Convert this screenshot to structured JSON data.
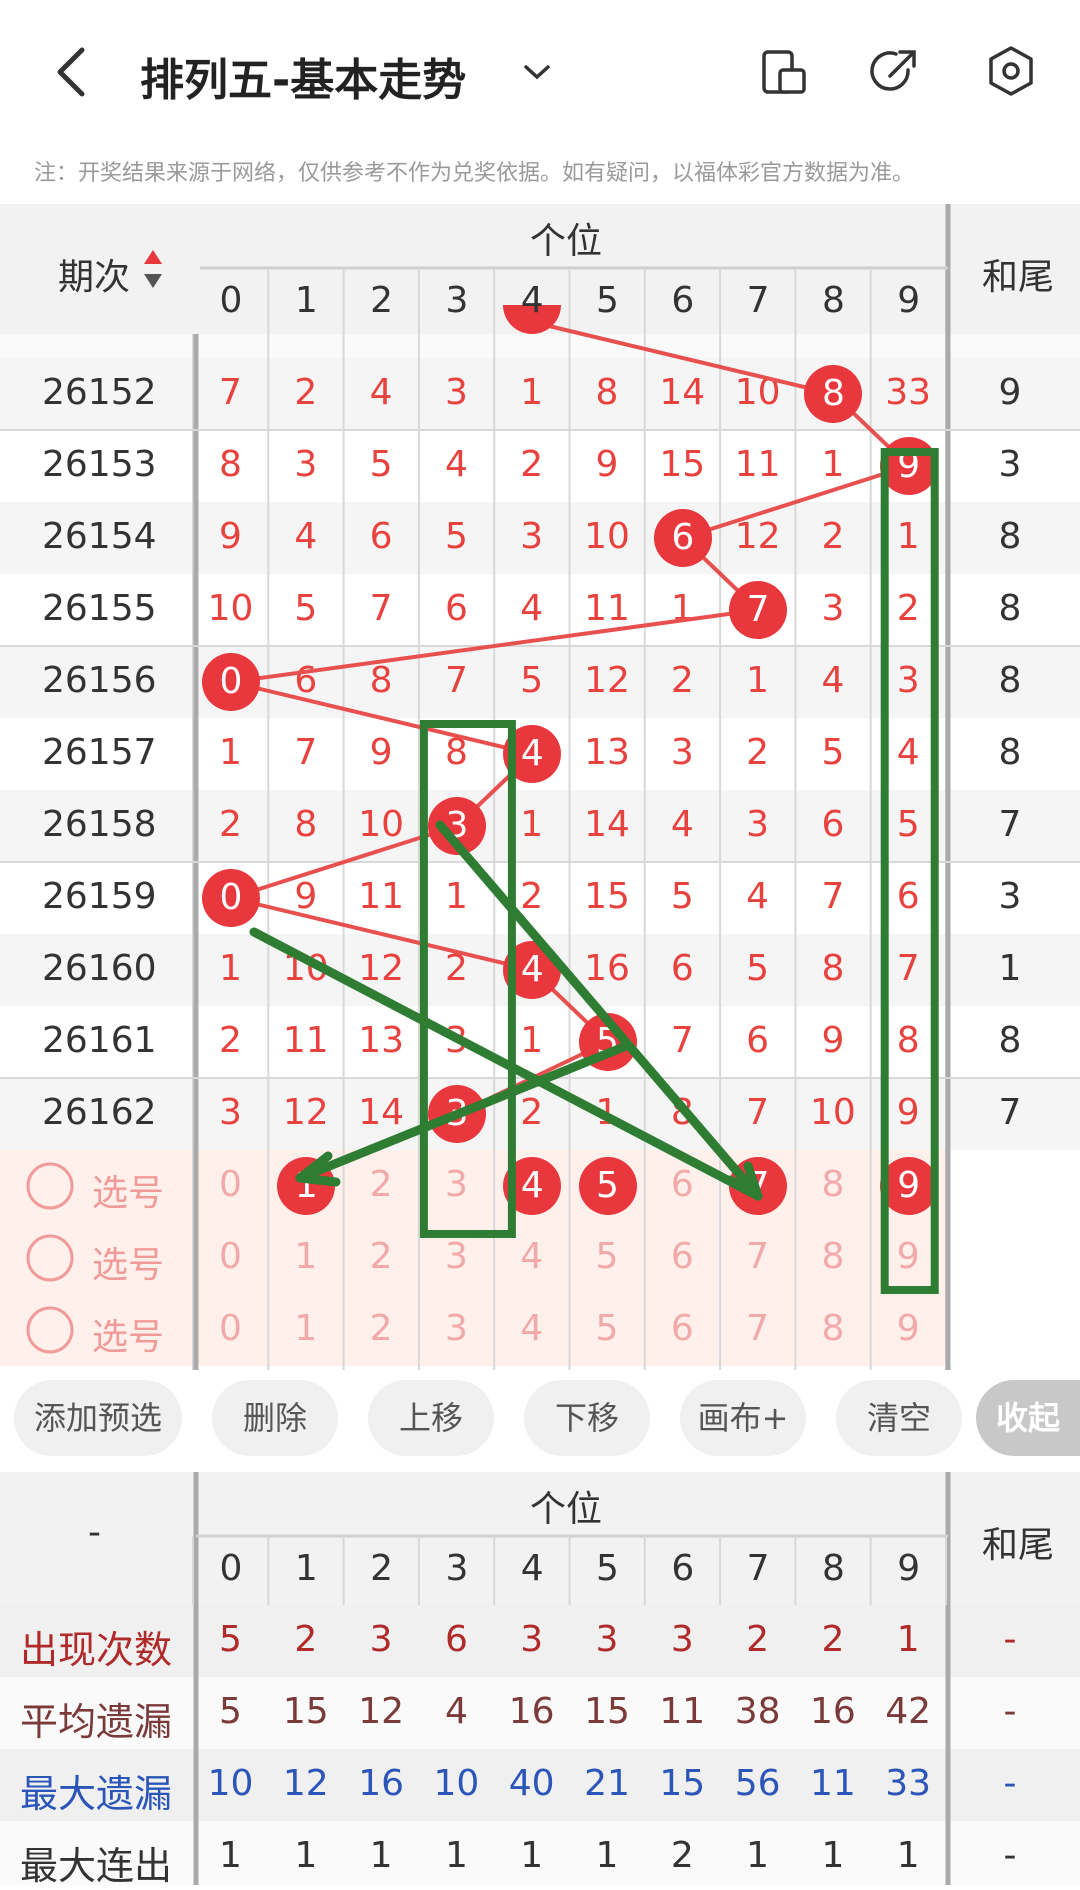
{
  "header": {
    "title": "排列五-基本走势",
    "notice": "注：开奖结果来源于网络，仅供参考不作为兑奖依据。如有疑问，以福体彩官方数据为准。"
  },
  "table": {
    "period_header": "期次",
    "group_header": "个位",
    "sum_header": "和尾",
    "digits": [
      "0",
      "1",
      "2",
      "3",
      "4",
      "5",
      "6",
      "7",
      "8",
      "9"
    ],
    "rows": [
      {
        "period": "26152",
        "cells": [
          "7",
          "2",
          "4",
          "3",
          "1",
          "8",
          "14",
          "10",
          "8",
          "33"
        ],
        "hit": 8,
        "sum": "9"
      },
      {
        "period": "26153",
        "cells": [
          "8",
          "3",
          "5",
          "4",
          "2",
          "9",
          "15",
          "11",
          "1",
          "9"
        ],
        "hit": 9,
        "sum": "3"
      },
      {
        "period": "26154",
        "cells": [
          "9",
          "4",
          "6",
          "5",
          "3",
          "10",
          "6",
          "12",
          "2",
          "1"
        ],
        "hit": 6,
        "sum": "8"
      },
      {
        "period": "26155",
        "cells": [
          "10",
          "5",
          "7",
          "6",
          "4",
          "11",
          "1",
          "7",
          "3",
          "2"
        ],
        "hit": 7,
        "sum": "8"
      },
      {
        "period": "26156",
        "cells": [
          "0",
          "6",
          "8",
          "7",
          "5",
          "12",
          "2",
          "1",
          "4",
          "3"
        ],
        "hit": 0,
        "sum": "8"
      },
      {
        "period": "26157",
        "cells": [
          "1",
          "7",
          "9",
          "8",
          "4",
          "13",
          "3",
          "2",
          "5",
          "4"
        ],
        "hit": 4,
        "sum": "8"
      },
      {
        "period": "26158",
        "cells": [
          "2",
          "8",
          "10",
          "3",
          "1",
          "14",
          "4",
          "3",
          "6",
          "5"
        ],
        "hit": 3,
        "sum": "7"
      },
      {
        "period": "26159",
        "cells": [
          "0",
          "9",
          "11",
          "1",
          "2",
          "15",
          "5",
          "4",
          "7",
          "6"
        ],
        "hit": 0,
        "sum": "3"
      },
      {
        "period": "26160",
        "cells": [
          "1",
          "10",
          "12",
          "2",
          "4",
          "16",
          "6",
          "5",
          "8",
          "7"
        ],
        "hit": 4,
        "sum": "1"
      },
      {
        "period": "26161",
        "cells": [
          "2",
          "11",
          "13",
          "3",
          "1",
          "5",
          "7",
          "6",
          "9",
          "8"
        ],
        "hit": 5,
        "sum": "8"
      },
      {
        "period": "26162",
        "cells": [
          "3",
          "12",
          "14",
          "3",
          "2",
          "1",
          "8",
          "7",
          "10",
          "9"
        ],
        "hit": 3,
        "sum": "7"
      }
    ],
    "select_rows": [
      {
        "label": "选号",
        "selected": [
          1,
          4,
          5,
          7,
          9
        ]
      },
      {
        "label": "选号",
        "selected": []
      },
      {
        "label": "选号",
        "selected": []
      }
    ]
  },
  "actions": {
    "add": "添加预选",
    "delete": "删除",
    "up": "上移",
    "down": "下移",
    "canvas": "画布+",
    "clear": "清空",
    "collapse": "收起"
  },
  "stats": {
    "corner": "-",
    "group_header": "个位",
    "sum_header": "和尾",
    "rows": [
      {
        "label": "出现次数",
        "values": [
          "5",
          "2",
          "3",
          "6",
          "3",
          "3",
          "3",
          "2",
          "2",
          "1"
        ],
        "sum": "-",
        "color": "#b02a2a"
      },
      {
        "label": "平均遗漏",
        "values": [
          "5",
          "15",
          "12",
          "4",
          "16",
          "15",
          "11",
          "38",
          "16",
          "42"
        ],
        "sum": "-",
        "color": "#7a3a3a"
      },
      {
        "label": "最大遗漏",
        "values": [
          "10",
          "12",
          "16",
          "10",
          "40",
          "21",
          "15",
          "56",
          "11",
          "33"
        ],
        "sum": "-",
        "color": "#2b55b8"
      },
      {
        "label": "最大连出",
        "values": [
          "1",
          "1",
          "1",
          "1",
          "1",
          "1",
          "2",
          "1",
          "1",
          "1"
        ],
        "sum": "-",
        "color": "#333333"
      }
    ]
  },
  "colors": {
    "ball": "#e8383d",
    "line": "#e85050",
    "overlay": "#2e7d32",
    "select_bg": "#fff0ec"
  }
}
